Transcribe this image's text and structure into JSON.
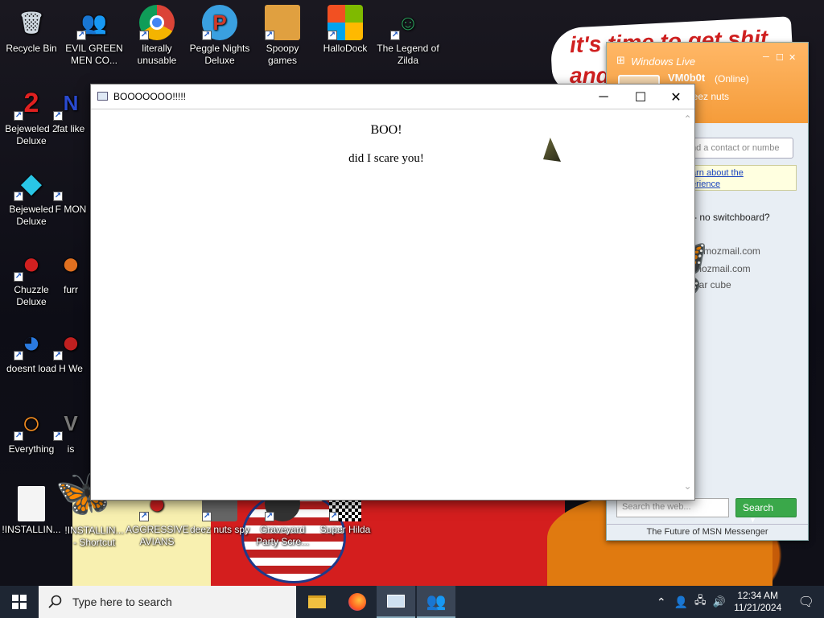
{
  "desktop": {
    "banner_text": "it's time to get shit",
    "banner_text2": "and",
    "icons": [
      {
        "label": "Recycle Bin",
        "glyph": "🗑",
        "color": "#cfd8e0"
      },
      {
        "label": "EVIL GREEN MEN CO...",
        "glyph": "👥",
        "color": "#3fbf3f"
      },
      {
        "label": "literally unusable",
        "glyph": "◉",
        "color": "#e8b020"
      },
      {
        "label": "Peggle Nights Deluxe",
        "glyph": "P",
        "color": "#d03a2a"
      },
      {
        "label": "Spoopy games",
        "glyph": "📁",
        "color": "#e0a040"
      },
      {
        "label": "HalloDock",
        "glyph": "⊞",
        "color": "#e8562a"
      },
      {
        "label": "The Legend of Zilda",
        "glyph": "☺",
        "color": "#2a9d5a"
      },
      {
        "label": "Bejeweled 2 Deluxe",
        "glyph": "2",
        "color": "#2060e0"
      },
      {
        "label": "fat like",
        "glyph": "N",
        "color": "#2a4ad0"
      },
      {
        "label": "Bejeweled Deluxe",
        "glyph": "◆",
        "color": "#29c6e6"
      },
      {
        "label": "F MON",
        "glyph": "F",
        "color": "#888"
      },
      {
        "label": "Chuzzle Deluxe",
        "glyph": "●",
        "color": "#d02020"
      },
      {
        "label": "furr",
        "glyph": "●",
        "color": "#e07020"
      },
      {
        "label": "doesnt load",
        "glyph": "◕",
        "color": "#2a7ae0"
      },
      {
        "label": "H We",
        "glyph": "●",
        "color": "#c02020"
      },
      {
        "label": "Everything",
        "glyph": "○",
        "color": "#f08a20"
      },
      {
        "label": "is",
        "glyph": "V",
        "color": "#777"
      },
      {
        "label": "!INSTALLIN...",
        "glyph": "📄",
        "color": "#eee"
      },
      {
        "label": "!INSTALLIN... - Shortcut",
        "glyph": "📄",
        "color": "#eee"
      },
      {
        "label": "AGGRESSIVE AVIANS",
        "glyph": "●",
        "color": "#d02020"
      },
      {
        "label": "deez nuts spy",
        "glyph": "▣",
        "color": "#555"
      },
      {
        "label": "Graveyard Party Scre...",
        "glyph": "▣",
        "color": "#333"
      },
      {
        "label": "Super Hilda",
        "glyph": "▦",
        "color": "#999"
      }
    ]
  },
  "msn": {
    "brand": "Windows Live",
    "username": "VM0b0t",
    "status": "(Online)",
    "message": "rate deez nuts",
    "search_contact_placeholder": "nd a contact or numbe",
    "learn_link": "arn about the",
    "learn_link2": "erience",
    "line_no_switchboard": "- no switchboard?",
    "contact1": "@mozmail.com",
    "contact2": "mozmail.com",
    "contact3": "ear cube",
    "web_search_placeholder": "Search the web...",
    "search_button": "Search",
    "footer": "The Future of MSN Messenger"
  },
  "dialog": {
    "title": "BOOOOOOO!!!!!",
    "heading": "BOO!",
    "body": "did I scare you!",
    "minimize": "─",
    "maximize": "☐",
    "close": "✕"
  },
  "taskbar": {
    "search_placeholder": "Type here to search",
    "apps": [
      {
        "name": "file-explorer",
        "glyph": "📁",
        "color": "#f0c040"
      },
      {
        "name": "firefox",
        "glyph": "●",
        "color": "#ff7a20"
      },
      {
        "name": "app-window",
        "glyph": "▣",
        "color": "#cfe0f0"
      },
      {
        "name": "msn-messenger",
        "glyph": "👥",
        "color": "#3fbf3f"
      }
    ],
    "time": "12:34 AM",
    "date": "11/21/2024",
    "tray": {
      "chevron": "⌃",
      "network": "🖧",
      "volume": "🔊",
      "notification": "🗨"
    }
  }
}
